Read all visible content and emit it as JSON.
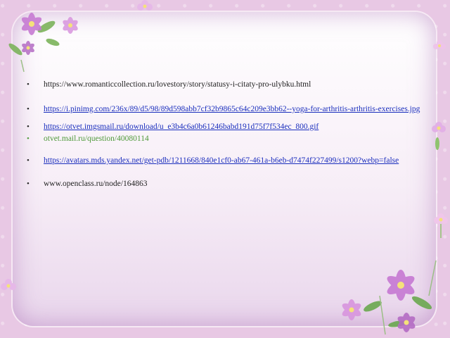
{
  "colors": {
    "frame": "#e8c8e4",
    "link": "#1a2ebd",
    "text": "#222222",
    "green_text": "#4e9a3a",
    "flower_petal": "#c77bd3",
    "flower_center": "#f4e27a",
    "leaf": "#6aa84f"
  },
  "decorations": [
    "flower-cluster-top-left",
    "flower-cluster-bottom-right",
    "small-flower-icons"
  ],
  "sources": [
    {
      "text": "https://www.romanticcollection.ru/lovestory/story/statusy-i-citaty-pro-ulybku.html"
    },
    {
      "text": "https://i.pinimg.com/236x/89/d5/98/89d598abb7cf32b9865c64c209e3bb62--yoga-for-arthritis-arthritis-exercises.jpg"
    },
    {
      "text": "https://otvet.imgsmail.ru/download/u_e3b4c6a0b61246babd191d75f7f534ec_800.gif"
    },
    {
      "text": "otvet.mail.ru/question/40080114"
    },
    {
      "text": "https://avatars.mds.yandex.net/get-pdb/1211668/840e1cf0-ab67-461a-b6eb-d7474f227499/s1200?webp=false"
    },
    {
      "text": "www.openclass.ru/node/164863"
    }
  ]
}
